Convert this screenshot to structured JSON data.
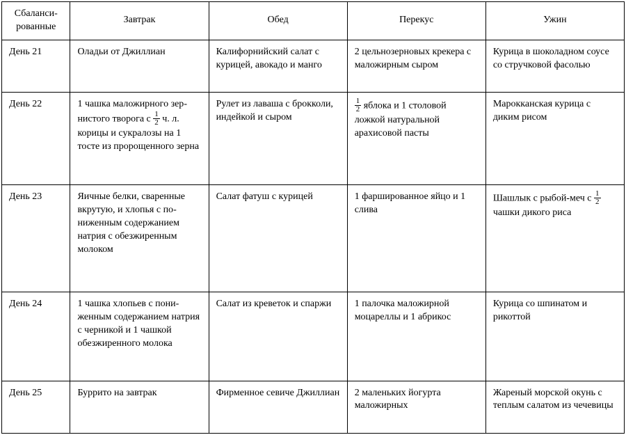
{
  "headers": {
    "type": "Сбаланси­рованные",
    "breakfast": "Завтрак",
    "lunch": "Обед",
    "snack": "Перекус",
    "dinner": "Ужин"
  },
  "rows": [
    {
      "day": "День 21",
      "breakfast": "Оладьи от Джиллиан",
      "lunch": "Калифорнийский салат с курицей, авокадо и манго",
      "snack": "2 цельнозерновых крекера с маложир­ным сыром",
      "dinner": "Курица в шоколадном соусе со стручковой фасолью"
    },
    {
      "day": "День 22",
      "breakfast_parts": [
        "1 чашка маложирного зер­нистого творога с ",
        {
          "num": "1",
          "den": "2"
        },
        " ч. л. корицы и сукралозы на 1 тосте из пророщенного зерна"
      ],
      "lunch": "Рулет из лаваша с брокколи, индейкой и сыром",
      "snack_parts": [
        {
          "num": "1",
          "den": "2"
        },
        " яблока и 1 сто­ловой ложкой нату­ральной арахисовой пасты"
      ],
      "dinner": "Марокканская курица с диким рисом"
    },
    {
      "day": "День 23",
      "breakfast": "Яичные белки, сваренные вкрутую, и хлопья с по­ниженным содержанием натрия с обезжиренным молоком",
      "lunch": "Салат фатуш с курицей",
      "snack": "1 фаршированное яйцо и 1 слива",
      "dinner_parts": [
        "Шашлык с рыбой-меч с ",
        {
          "num": "1",
          "den": "2"
        },
        " чашки дикого риса"
      ]
    },
    {
      "day": "День 24",
      "breakfast": "1 чашка хлопьев с пони­женным содержанием натрия с черникой и 1 чашкой обезжиренного молока",
      "lunch": "Салат из креветок и спаржи",
      "snack": "1 палочка маложир­ной моцареллы и 1 абрикос",
      "dinner": "Курица со шпинатом и рикоттой"
    },
    {
      "day": "День 25",
      "breakfast": "Буррито на завтрак",
      "lunch": "Фирменное севиче Джиллиан",
      "snack": "2 маленьких йогурта маложирных",
      "dinner": "Жареный морской окунь с теплым салатом из чече­вицы"
    }
  ]
}
